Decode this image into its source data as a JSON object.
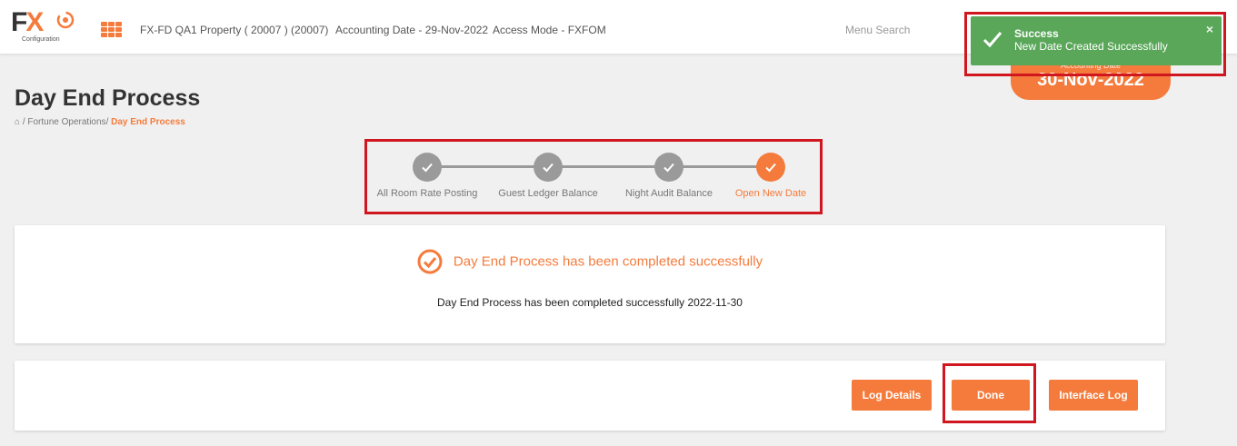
{
  "header": {
    "logo_text": "FX",
    "logo_sub": "Configuration",
    "property": "FX-FD QA1 Property ( 20007 ) (20007)",
    "accounting_date": "Accounting Date - 29-Nov-2022",
    "access_mode": "Access Mode - FXFOM",
    "menu_search_placeholder": "Menu Search"
  },
  "page": {
    "title": "Day End Process",
    "breadcrumb": {
      "home_icon": "home-icon",
      "section": "Fortune Operations",
      "current": "Day End Process"
    }
  },
  "date_badge": {
    "label": "Accounting Date",
    "date": "30-Nov-2022"
  },
  "stepper": {
    "steps": [
      {
        "label": "All Room Rate Posting",
        "status": "done"
      },
      {
        "label": "Guest Ledger Balance",
        "status": "done"
      },
      {
        "label": "Night Audit Balance",
        "status": "done"
      },
      {
        "label": "Open New Date",
        "status": "active"
      }
    ]
  },
  "result": {
    "heading": "Day End Process has been completed successfully",
    "message": "Day End Process has been completed successfully 2022-11-30"
  },
  "actions": {
    "log_details": "Log Details",
    "done": "Done",
    "interface_log": "Interface Log"
  },
  "toast": {
    "title": "Success",
    "message": "New Date Created Successfully",
    "close": "×"
  },
  "colors": {
    "accent": "#f47b3c",
    "toast": "#5aa75a",
    "highlight": "#d0161e",
    "inactive_step": "#9a9a9a"
  }
}
